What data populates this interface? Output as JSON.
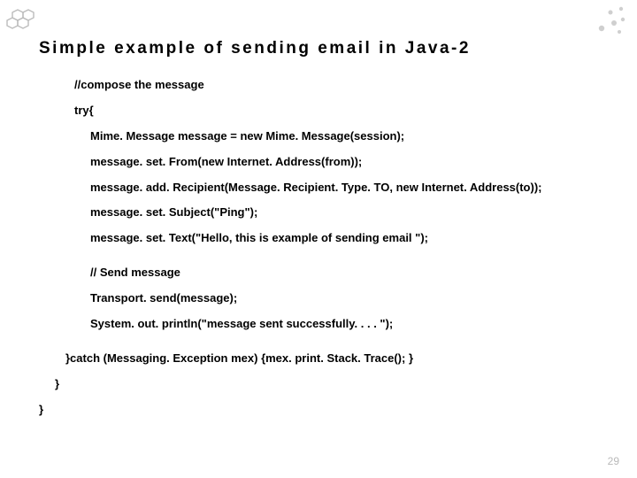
{
  "title": "Simple example of sending email in Java-2",
  "code": {
    "c1": "//compose the message",
    "c2": "try{",
    "c3": "Mime. Message message = new Mime. Message(session);",
    "c4": "message. set. From(new Internet. Address(from));",
    "c5": "message. add. Recipient(Message. Recipient. Type. TO, new Internet. Address(to));",
    "c6": "message. set. Subject(\"Ping\");",
    "c7": "message. set. Text(\"Hello, this is example of sending email \");",
    "c8": "// Send message",
    "c9": "Transport. send(message);",
    "c10": "System. out. println(\"message sent successfully. . . . \");",
    "c11": "}catch (Messaging. Exception mex) {mex. print. Stack. Trace(); }",
    "c12": "}",
    "c13": "}"
  },
  "pageNumber": "29"
}
